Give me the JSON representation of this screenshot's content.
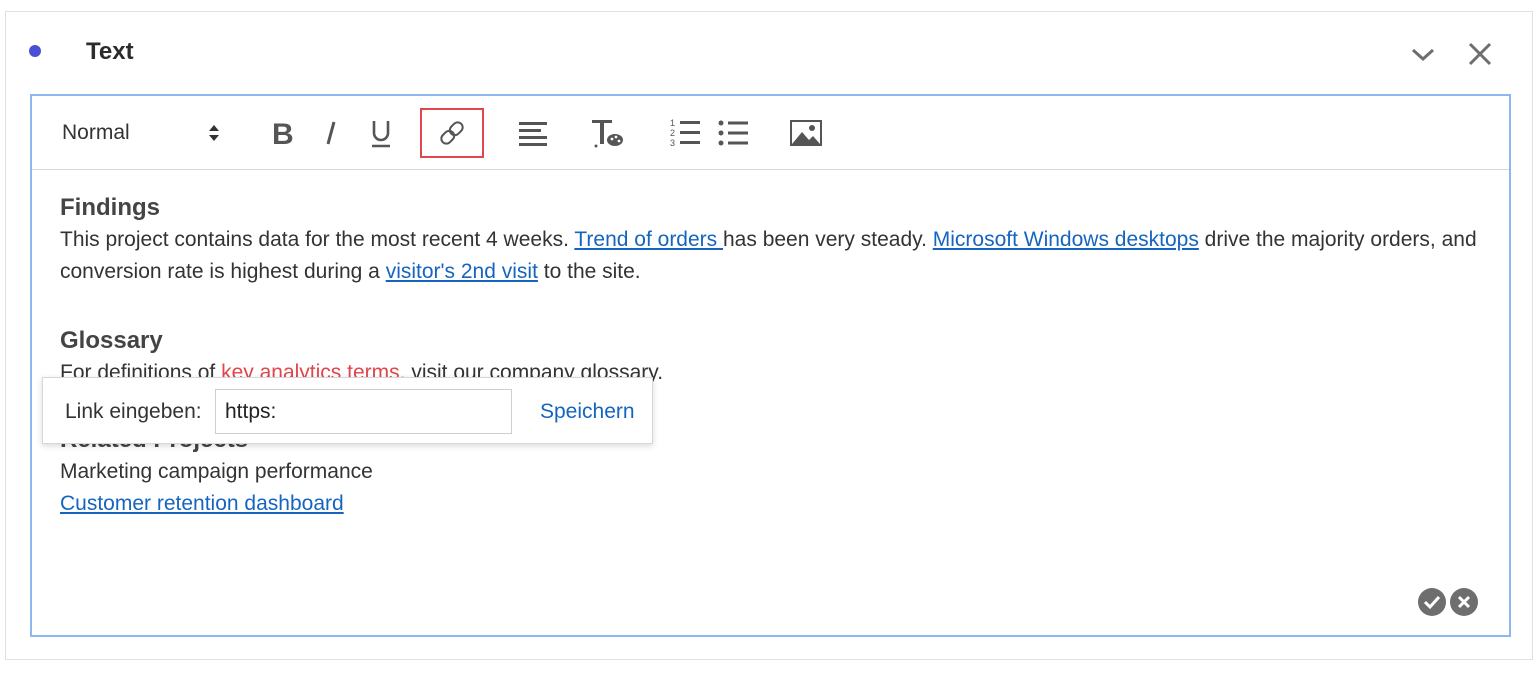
{
  "panel": {
    "title": "Text",
    "dot_color": "#4b4fd6",
    "collapse_icon": "chevron-down-icon",
    "close_icon": "close-icon"
  },
  "toolbar": {
    "style_select": {
      "value": "Normal"
    },
    "buttons": [
      "bold-icon",
      "italic-icon",
      "underline-icon",
      "link-icon",
      "align-icon",
      "text-color-icon",
      "ordered-list-icon",
      "bullet-list-icon",
      "image-icon"
    ],
    "active_button": "link-icon",
    "highlight_color": "#e0464a"
  },
  "content": {
    "findings": {
      "heading": "Findings",
      "t1": "This project contains data for the most recent 4 weeks. ",
      "link1": "Trend of orders ",
      "t2": "has been very steady. ",
      "link2": "Microsoft Windows desktops",
      "t3": " drive the majority orders, and conversion rate is highest during a ",
      "link3": "visitor's 2nd visit",
      "t4": " to the site."
    },
    "glossary": {
      "heading": "Glossary",
      "t1": "For definitions of ",
      "link": "key analytics terms",
      "t2": ", visit our company glossary."
    },
    "related": {
      "heading": "Related Projects",
      "item1": "Marketing campaign performance",
      "item2": "Customer retention dashboard"
    },
    "link_color": "#1565c0"
  },
  "link_popover": {
    "label": "Link eingeben:",
    "input_value": "https:",
    "save_label": "Speichern"
  },
  "editor_actions": {
    "confirm_icon": "check-circle-icon",
    "cancel_icon": "x-circle-icon"
  }
}
